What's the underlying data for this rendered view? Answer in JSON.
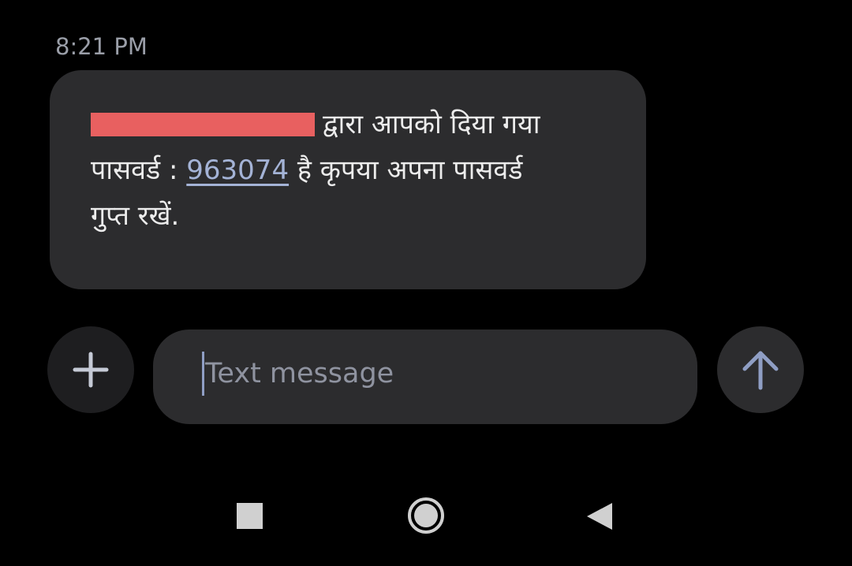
{
  "conversation": {
    "timestamp": "8:21 PM",
    "message": {
      "line1_visible": "द्वारा आपको दिया गया",
      "line2_prefix": "पासवर्ड : ",
      "otp_code": "963074",
      "line2_suffix": " है कृपया अपना पासवर्ड",
      "line3": "गुप्त रखें."
    }
  },
  "composer": {
    "placeholder": "Text message",
    "attach_icon": "plus-icon",
    "send_icon": "arrow-up-icon"
  },
  "navigation": {
    "recents_icon": "square-icon",
    "home_icon": "circle-icon",
    "back_icon": "triangle-back-icon"
  },
  "colors": {
    "background": "#000000",
    "bubble": "#2c2c2e",
    "link": "#a4b3d6",
    "redaction": "#e86060"
  }
}
